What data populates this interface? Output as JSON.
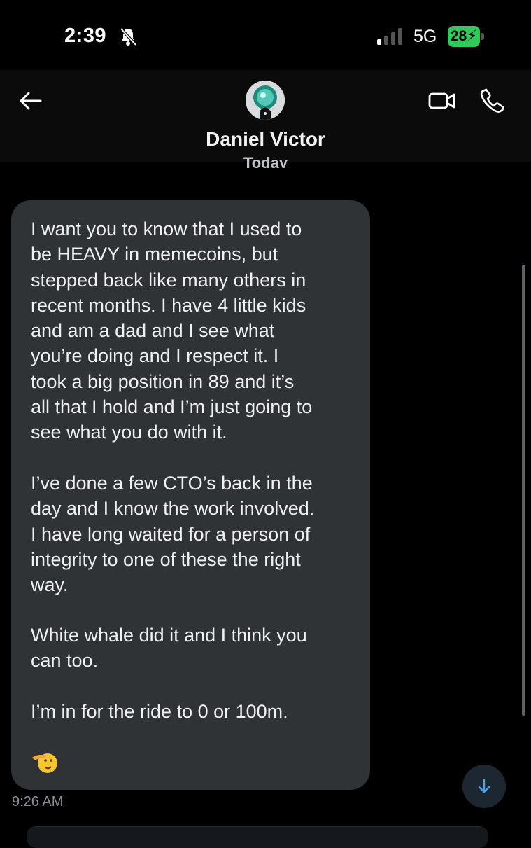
{
  "status_bar": {
    "time": "2:39",
    "network": "5G",
    "battery": "28"
  },
  "header": {
    "contact_name": "Daniel Victor",
    "date_separator": "Today"
  },
  "conversation": {
    "message": {
      "paragraphs": [
        "I want you to know that I used to\nbe HEAVY in memecoins, but\nstepped back like many others in\nrecent months. I have 4 little kids\nand am a dad and I see what\nyou’re doing and I respect it. I\ntook a big position in 89 and it’s\nall that I hold and I’m just going to\nsee what you do with it.",
        "I’ve done a few CTO’s back in the\nday and I know the work involved.\nI have long waited for a person of\nintegrity to one of these the right\nway.",
        "White whale did it and I think you\ncan too.",
        "I’m in for the ride to 0 or 100m."
      ],
      "emoji_icon": "saluting-face-icon",
      "timestamp": "9:26 AM"
    }
  },
  "colors": {
    "background": "#000000",
    "bubble": "#2f3336",
    "accent": "#1d9bf0",
    "battery": "#34c759"
  }
}
